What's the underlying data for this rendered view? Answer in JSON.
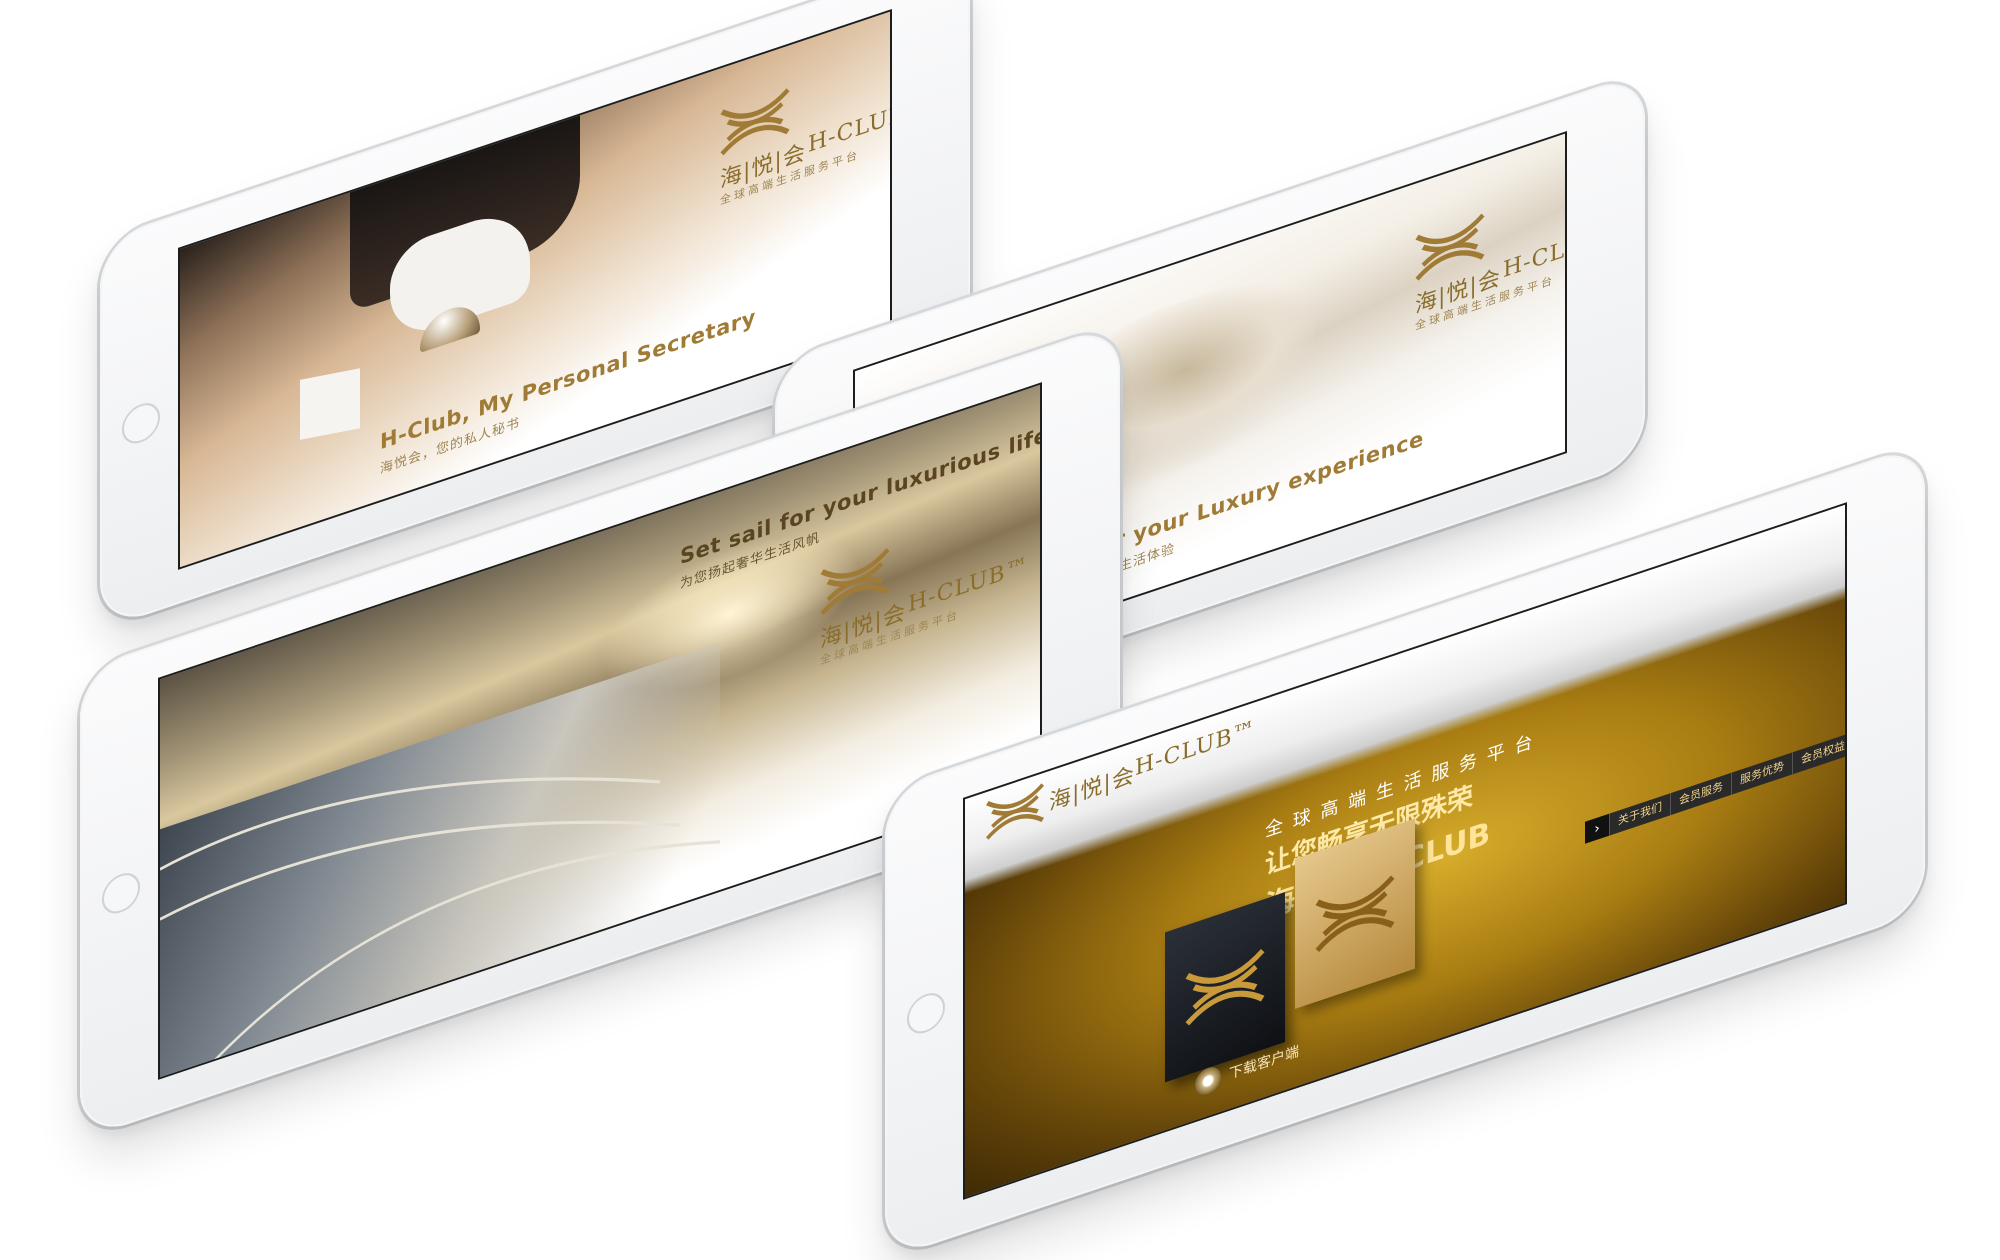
{
  "brand": {
    "logo_cn": "海|悦|会",
    "logo_en": "H-CLUB™",
    "logo_sub": "全球高端生活服务平台",
    "gold": "#a07b36"
  },
  "tablets": [
    {
      "tagline": "H-Club, My Personal Secretary",
      "tagline_sub": "海悦会，您的私人秘书"
    },
    {
      "tagline": "Just for your Luxury experience",
      "tagline_sub": "为您打造奢华生活体验"
    },
    {
      "tagline": "Set sail for your luxurious life",
      "tagline_sub": "为您扬起奢华生活风帆"
    },
    {
      "headline_top": "全 球 高 端 生 活 服 务 平 台",
      "headline_mid": "让您畅享无限殊荣",
      "headline_bottom": "海悦会 H-CLUB",
      "nav": [
        "关于我们",
        "会员服务",
        "服务优势",
        "会员权益"
      ],
      "download": "下载客户端"
    }
  ]
}
